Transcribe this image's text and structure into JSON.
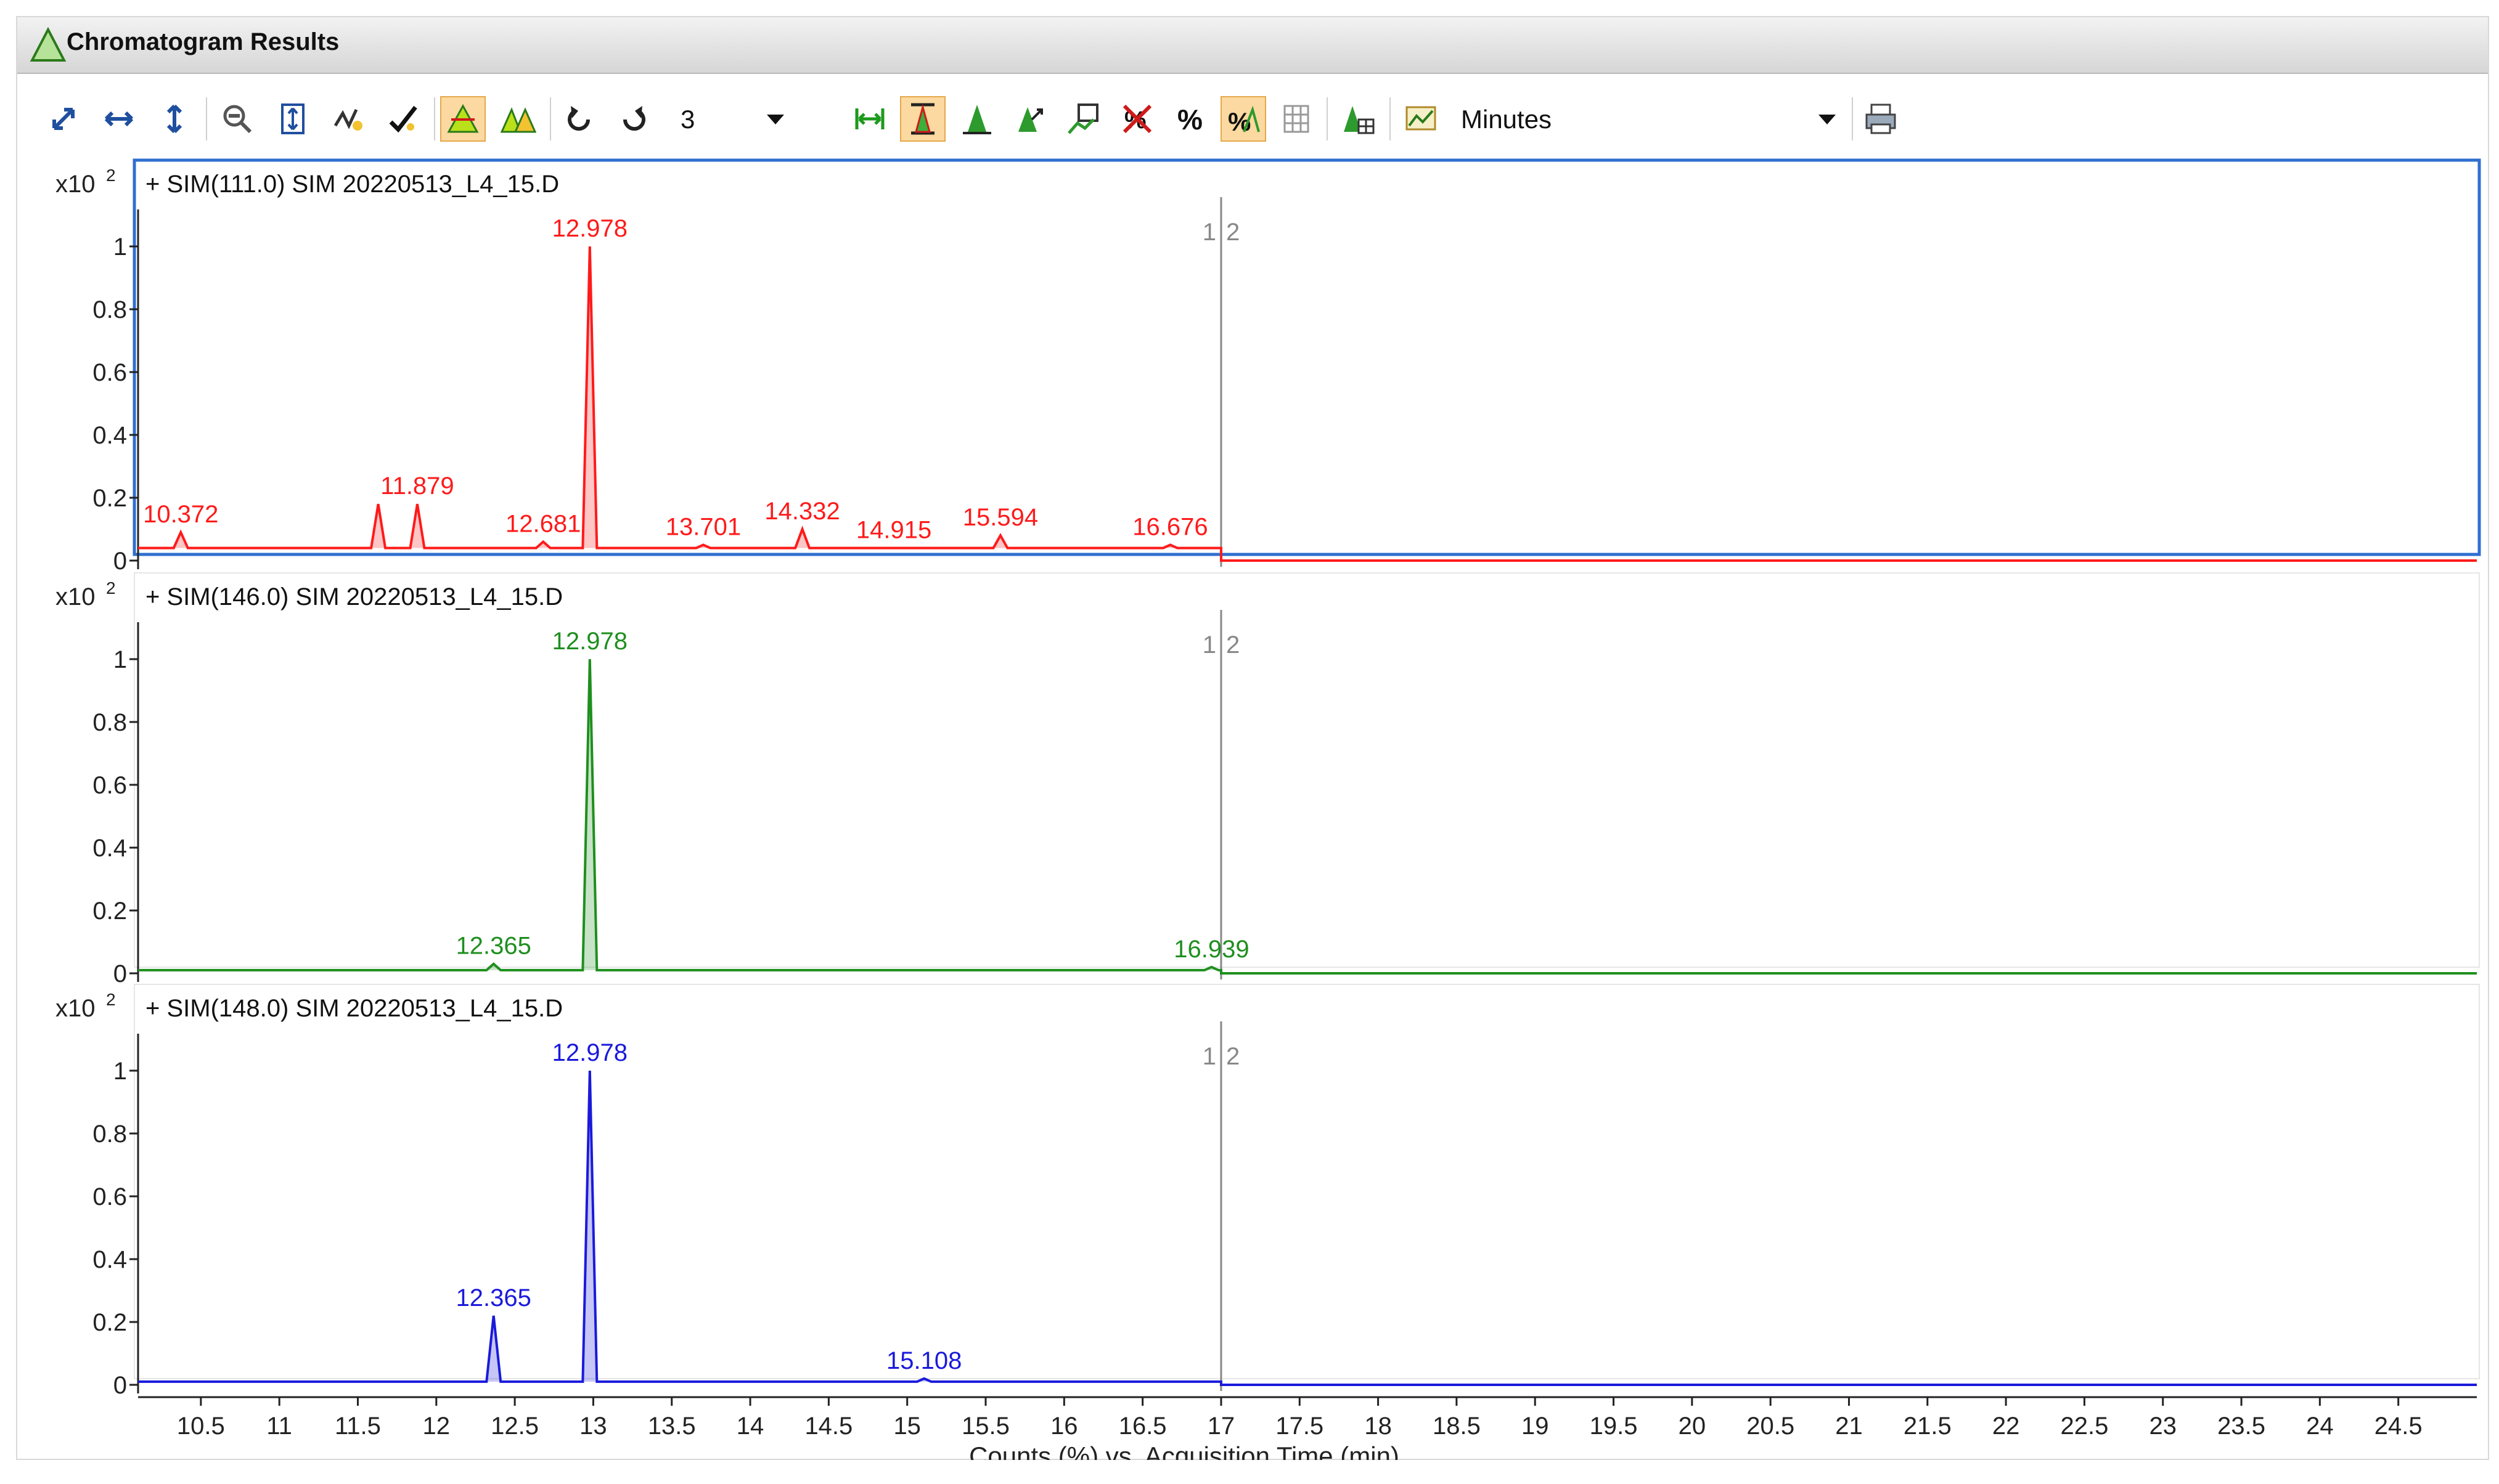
{
  "window": {
    "title": "Chromatogram Results"
  },
  "toolbar": {
    "count_value": "3",
    "units_value": "Minutes",
    "icons": [
      "autoscale-xy-icon",
      "autoscale-x-icon",
      "autoscale-y-icon",
      "zoom-out-icon",
      "fit-y-icon",
      "anchor-icon",
      "integrate-icon",
      "peak-label-icon",
      "peak-overlay-icon",
      "undo-icon",
      "redo-icon",
      "link-x-icon",
      "link-y-icon",
      "peak-icon",
      "peak-walk-icon",
      "export-icon",
      "clear-percent-icon",
      "percent-icon",
      "normalize-icon",
      "grid-icon",
      "peak-table-icon",
      "units-icon",
      "print-icon"
    ]
  },
  "accent": {
    "active_button": "#fbd9a0",
    "selected_border": "#2f6fcf",
    "red": "#ff1a1a",
    "green": "#1f8f1f",
    "blue": "#1a1adb"
  },
  "chart_data": {
    "type": "line",
    "xlabel": "Counts (%) vs. Acquisition Time (min)",
    "xlim": [
      10.1,
      25.0
    ],
    "x_ticks": [
      10.5,
      11,
      11.5,
      12,
      12.5,
      13,
      13.5,
      14,
      14.5,
      15,
      15.5,
      16,
      16.5,
      17,
      17.5,
      18,
      18.5,
      19,
      19.5,
      20,
      20.5,
      21,
      21.5,
      22,
      22.5,
      23,
      23.5,
      24,
      24.5
    ],
    "x_tick_labels": [
      "10.5",
      "11",
      "11.5",
      "12",
      "12.5",
      "13",
      "13.5",
      "14",
      "14.5",
      "15",
      "15.5",
      "16",
      "16.5",
      "17",
      "17.5",
      "18",
      "18.5",
      "19",
      "19.5",
      "20",
      "20.5",
      "21",
      "21.5",
      "22",
      "22.5",
      "23",
      "23.5",
      "24",
      "24.5"
    ],
    "segment_marker": {
      "x": 17,
      "labels": [
        "1",
        "2"
      ]
    },
    "panels": [
      {
        "title": "+ SIM(111.0) SIM 20220513_L4_15.D",
        "scale_label": "x10 2",
        "color": "#ff1a1a",
        "ylim": [
          0,
          1.0
        ],
        "y_ticks": [
          0,
          0.2,
          0.4,
          0.6,
          0.8,
          1
        ],
        "y_tick_labels": [
          "0",
          "0.2",
          "0.4",
          "0.6",
          "0.8",
          "1"
        ],
        "baseline": 0.04,
        "peaks": [
          {
            "rt": 10.372,
            "height": 0.09,
            "label": "10.372"
          },
          {
            "rt": 11.63,
            "height": 0.18,
            "label": ""
          },
          {
            "rt": 11.879,
            "height": 0.18,
            "label": "11.879"
          },
          {
            "rt": 12.681,
            "height": 0.06,
            "label": "12.681"
          },
          {
            "rt": 12.978,
            "height": 1.0,
            "label": "12.978"
          },
          {
            "rt": 13.701,
            "height": 0.05,
            "label": "13.701"
          },
          {
            "rt": 14.332,
            "height": 0.1,
            "label": "14.332"
          },
          {
            "rt": 14.915,
            "height": 0.04,
            "label": "14.915"
          },
          {
            "rt": 15.594,
            "height": 0.08,
            "label": "15.594"
          },
          {
            "rt": 16.676,
            "height": 0.05,
            "label": "16.676"
          }
        ]
      },
      {
        "title": "+ SIM(146.0) SIM 20220513_L4_15.D",
        "scale_label": "x10 2",
        "color": "#1f8f1f",
        "ylim": [
          0,
          1.0
        ],
        "y_ticks": [
          0,
          0.2,
          0.4,
          0.6,
          0.8,
          1
        ],
        "y_tick_labels": [
          "0",
          "0.2",
          "0.4",
          "0.6",
          "0.8",
          "1"
        ],
        "baseline": 0.01,
        "peaks": [
          {
            "rt": 12.365,
            "height": 0.03,
            "label": "12.365"
          },
          {
            "rt": 12.978,
            "height": 1.0,
            "label": "12.978"
          },
          {
            "rt": 16.939,
            "height": 0.02,
            "label": "16.939"
          }
        ]
      },
      {
        "title": "+ SIM(148.0) SIM 20220513_L4_15.D",
        "scale_label": "x10 2",
        "color": "#1a1adb",
        "ylim": [
          0,
          1.0
        ],
        "y_ticks": [
          0,
          0.2,
          0.4,
          0.6,
          0.8,
          1
        ],
        "y_tick_labels": [
          "0",
          "0.2",
          "0.4",
          "0.6",
          "0.8",
          "1"
        ],
        "baseline": 0.01,
        "peaks": [
          {
            "rt": 12.365,
            "height": 0.22,
            "label": "12.365"
          },
          {
            "rt": 12.978,
            "height": 1.0,
            "label": "12.978"
          },
          {
            "rt": 15.108,
            "height": 0.02,
            "label": "15.108"
          }
        ]
      }
    ]
  }
}
